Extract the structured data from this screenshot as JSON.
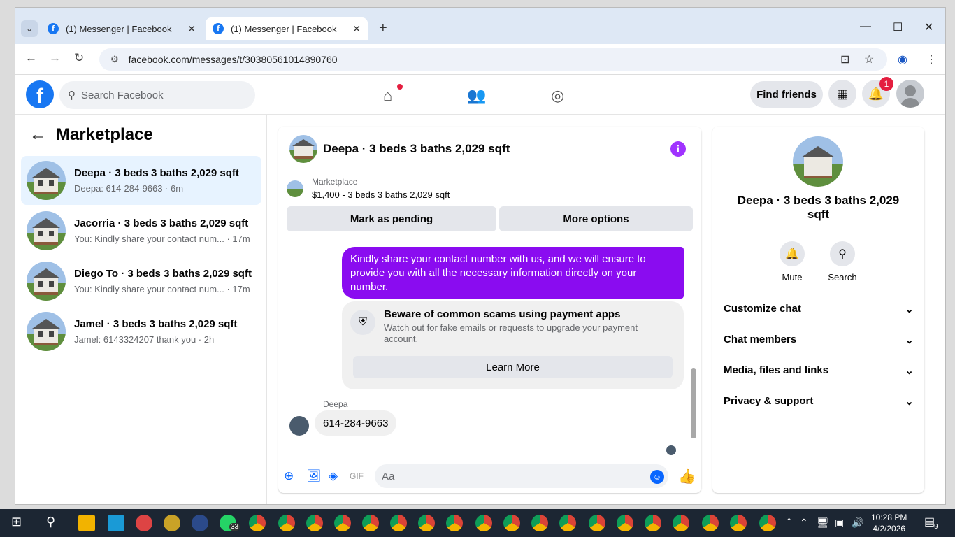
{
  "browser": {
    "tabs": [
      {
        "label": "(1) Messenger | Facebook"
      },
      {
        "label": "(1) Messenger | Facebook"
      }
    ],
    "url": "facebook.com/messages/t/30380561014890760"
  },
  "header": {
    "search_placeholder": "Search Facebook",
    "find_friends": "Find friends",
    "notification_count": "1"
  },
  "sidebar": {
    "title": "Marketplace",
    "conversations": [
      {
        "name": "Deepa · 3 beds 3 baths 2,029 sqft",
        "preview": "Deepa: 614-284-9663 · 6m"
      },
      {
        "name": "Jacorria · 3 beds 3 baths 2,029 sqft",
        "preview": "You: Kindly share your contact num... · 17m"
      },
      {
        "name": "Diego To · 3 beds 3 baths 2,029 sqft",
        "preview": "You: Kindly share your contact num... · 17m"
      },
      {
        "name": "Jamel · 3 beds 3 baths 2,029 sqft",
        "preview": "Jamel: 6143324207 thank you · 2h"
      }
    ]
  },
  "chat": {
    "title": "Deepa · 3 beds 3 baths 2,029 sqft",
    "marketplace_label": "Marketplace",
    "listing": "$1,400 - 3 beds 3 baths 2,029 sqft",
    "mark_pending": "Mark as pending",
    "more_options": "More options",
    "my_message": "Kindly share your contact number with us, and we will ensure to provide you with all the necessary information directly on your number.",
    "scam_title": "Beware of common scams using payment apps",
    "scam_desc": "Watch out for fake emails or requests to upgrade your payment account.",
    "learn_more": "Learn More",
    "sender_name": "Deepa",
    "their_message": "614-284-9663",
    "composer_placeholder": "Aa"
  },
  "right_panel": {
    "name": "Deepa · 3 beds 3 baths 2,029 sqft",
    "mute": "Mute",
    "search": "Search",
    "sections": [
      "Customize chat",
      "Chat members",
      "Media, files and links",
      "Privacy & support"
    ]
  },
  "taskbar": {
    "time": "10:28 PM",
    "date": "4/2/2026",
    "whatsapp_badge": "33",
    "notif_count": "9"
  }
}
